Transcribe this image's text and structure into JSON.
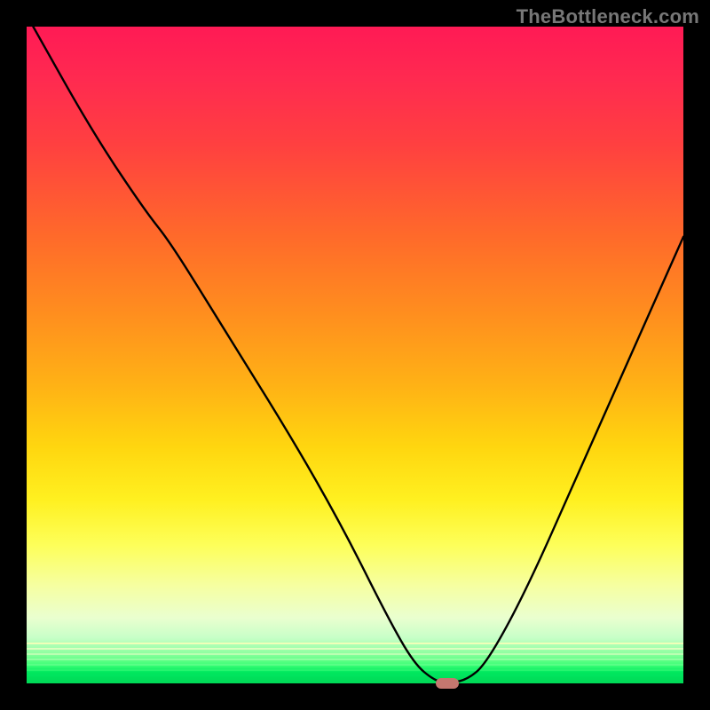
{
  "watermark": "TheBottleneck.com",
  "chart_data": {
    "type": "line",
    "title": "",
    "xlabel": "",
    "ylabel": "",
    "xlim": [
      0,
      100
    ],
    "ylim": [
      0,
      100
    ],
    "grid": false,
    "legend": false,
    "background": "red-yellow-green vertical gradient",
    "series": [
      {
        "name": "bottleneck-curve",
        "x": [
          1,
          10,
          18,
          22,
          30,
          40,
          48,
          55,
          59,
          62,
          64,
          67,
          70,
          76,
          84,
          92,
          100
        ],
        "y": [
          100,
          84,
          72,
          67,
          54,
          38,
          24,
          10,
          3,
          0.5,
          0,
          0.5,
          3,
          14,
          32,
          50,
          68
        ]
      }
    ],
    "minimum_marker": {
      "x": 64,
      "y": 0,
      "color": "#c4776f",
      "shape": "pill"
    },
    "gradient_stops": [
      {
        "pos": 0.0,
        "color": "#ff1a55"
      },
      {
        "pos": 0.32,
        "color": "#ff6a2a"
      },
      {
        "pos": 0.64,
        "color": "#ffd60f"
      },
      {
        "pos": 0.85,
        "color": "#f6ffa0"
      },
      {
        "pos": 0.97,
        "color": "#3dff76"
      },
      {
        "pos": 1.0,
        "color": "#00d856"
      }
    ]
  }
}
